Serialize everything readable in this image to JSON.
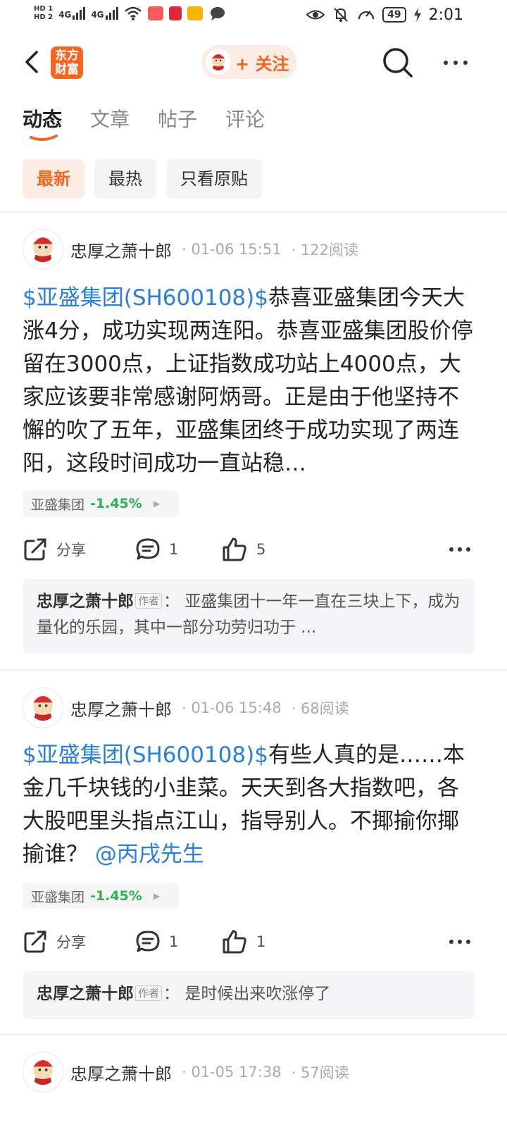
{
  "status_bar": {
    "hd1": "HD 1",
    "hd2": "HD 2",
    "net1": "4G",
    "net2": "4G",
    "battery": "49",
    "time": "2:01"
  },
  "header": {
    "logo_line1": "东方",
    "logo_line2": "财富",
    "follow_label": "+ 关注"
  },
  "tabs": [
    {
      "label": "动态",
      "active": true
    },
    {
      "label": "文章",
      "active": false
    },
    {
      "label": "帖子",
      "active": false
    },
    {
      "label": "评论",
      "active": false
    }
  ],
  "filters": [
    {
      "label": "最新",
      "active": true
    },
    {
      "label": "最热",
      "active": false
    },
    {
      "label": "只看原贴",
      "active": false
    }
  ],
  "colors": {
    "accent": "#f26522",
    "link": "#2b7fd8",
    "stock_down": "#2bb052"
  },
  "posts": [
    {
      "author": "忠厚之萧十郎",
      "time": "01-06 15:51",
      "reads": "122阅读",
      "stock_link": "$亚盛集团(SH600108)$",
      "text": "恭喜亚盛集团今天大涨4分，成功实现两连阳。恭喜亚盛集团股价停留在3000点，上证指数成功站上4000点，大家应该要非常感谢阿炳哥。正是由于他坚持不懈的吹了五年，亚盛集团终于成功实现了两连阳，这段时间成功一直站稳…",
      "mention": "",
      "stock_name": "亚盛集团",
      "stock_change": "-1.45%",
      "share_label": "分享",
      "comments": "1",
      "likes": "5",
      "reply_author": "忠厚之萧十郎",
      "reply_tag": "作者",
      "reply_text": "：  亚盛集团十一年一直在三块上下，成为量化的乐园，其中一部分功劳归功于 ..."
    },
    {
      "author": "忠厚之萧十郎",
      "time": "01-06 15:48",
      "reads": "68阅读",
      "stock_link": "$亚盛集团(SH600108)$",
      "text": "有些人真的是……本金几千块钱的小韭菜。天天到各大指数吧，各大股吧里头指点江山，指导别人。不揶揄你揶揄谁？",
      "mention": "@丙戌先生",
      "stock_name": "亚盛集团",
      "stock_change": "-1.45%",
      "share_label": "分享",
      "comments": "1",
      "likes": "1",
      "reply_author": "忠厚之萧十郎",
      "reply_tag": "作者",
      "reply_text": "：  是时候出来吹涨停了"
    },
    {
      "author": "忠厚之萧十郎",
      "time": "01-05 17:38",
      "reads": "57阅读"
    }
  ]
}
